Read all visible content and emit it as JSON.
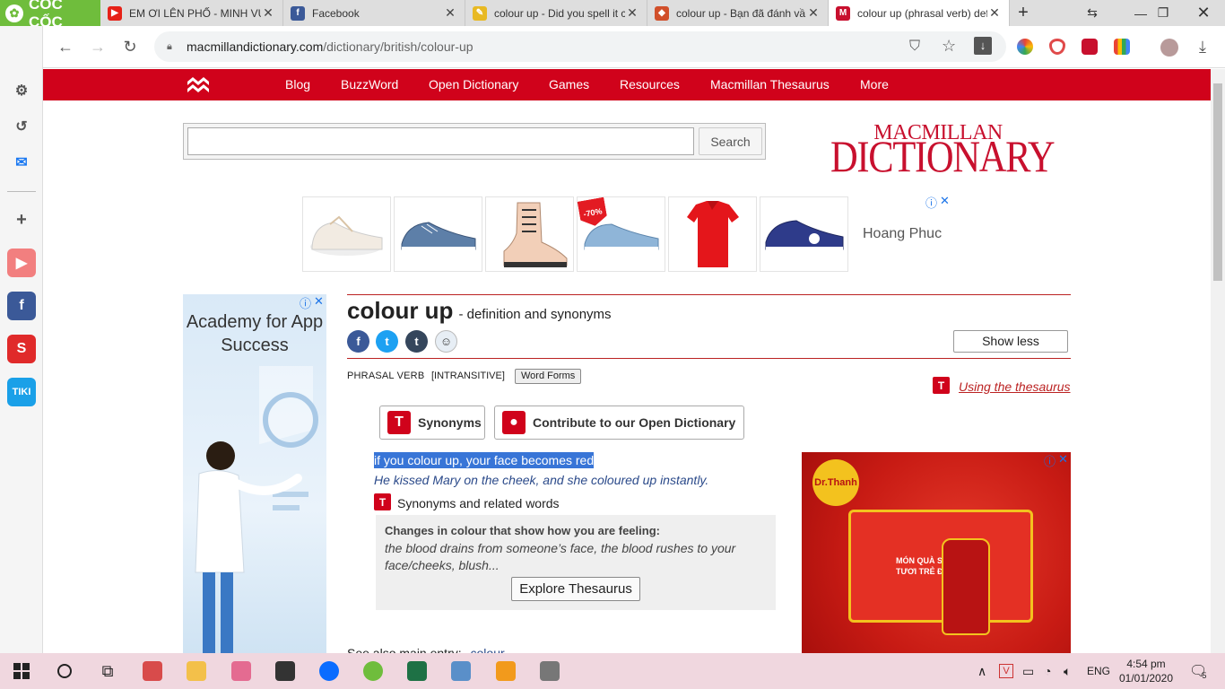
{
  "browser": {
    "brand": "CỐC CỐC",
    "tabs": [
      {
        "title": "EM ƠI LÊN PHỐ - MINH VƯƠNG",
        "favicon_color": "#e62117"
      },
      {
        "title": "Facebook",
        "favicon_color": "#3b5998"
      },
      {
        "title": "colour up - Did you spell it correctly",
        "favicon_color": "#e8b923"
      },
      {
        "title": "colour up - Bạn đã đánh vần",
        "favicon_color": "#d14f2a"
      },
      {
        "title": "colour up (phrasal verb) definition",
        "favicon_color": "#c8102e"
      }
    ],
    "url_host": "macmillandictionary.com",
    "url_path": "/dictionary/british/colour-up"
  },
  "site": {
    "nav": [
      "Blog",
      "BuzzWord",
      "Open Dictionary",
      "Games",
      "Resources",
      "Macmillan Thesaurus",
      "More"
    ],
    "search_placeholder": "",
    "search_button": "Search",
    "logo_top": "MACMILLAN",
    "logo_bottom": "DICTIONARY",
    "top_ad_brand": "Hoang Phuc",
    "top_ad_badge": "-70%",
    "left_ad_text": "Academy for App Success"
  },
  "entry": {
    "headword": "colour up",
    "subtitle": "- definition and synonyms",
    "show_less": "Show less",
    "pos": "PHRASAL VERB",
    "transitivity": "[INTRANSITIVE]",
    "word_forms": "Word Forms",
    "using_thesaurus": "Using the thesaurus",
    "synonyms_button": "Synonyms",
    "contribute_button": "Contribute to our Open Dictionary",
    "definition": "if you colour up, your face becomes red",
    "example": "He kissed Mary on the cheek, and she coloured up instantly.",
    "syn_related": "Synonyms and related words",
    "thes_heading": "Changes in colour that show how you are feeling:",
    "thes_words": "the blood drains from someone’s face, the blood rushes to your face/cheeks, blush...",
    "explore_button": "Explore Thesaurus",
    "see_also_label": "See also main entry:",
    "see_also_link": "colour"
  },
  "right_ad": {
    "brand": "Dr.Thanh",
    "tagline": "MÓN QUÀ SỨC KHỎE TƯƠI TRẺ ĐÓN XUÂN"
  },
  "taskbar": {
    "lang": "ENG",
    "time": "4:54 pm",
    "date": "01/01/2020",
    "notification_count": "5"
  }
}
